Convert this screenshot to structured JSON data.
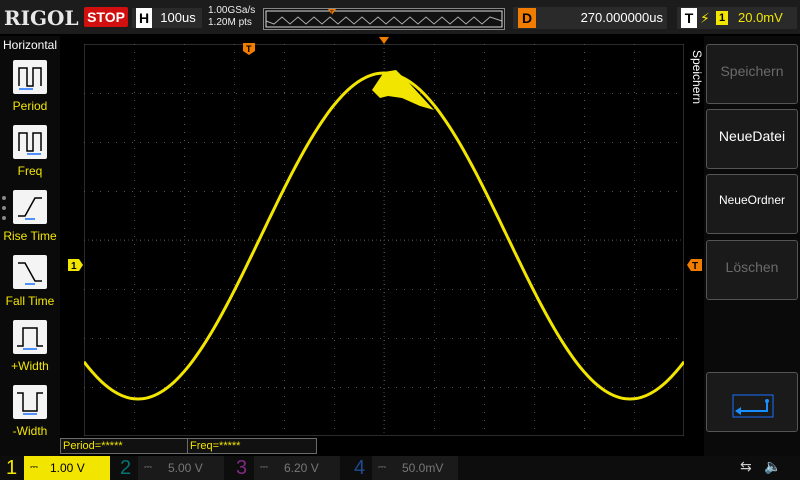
{
  "topbar": {
    "logo": "RIGOL",
    "run_state": "STOP",
    "horizontal_label": "H",
    "timebase": "100us",
    "sample_rate": "1.00GSa/s",
    "memory_depth": "1.20M pts",
    "delay_label": "D",
    "delay_value": "270.000000us",
    "trigger_label": "T",
    "trigger_source": "1",
    "trigger_level": "20.0mV"
  },
  "left_menu": {
    "title": "Horizontal",
    "items": [
      {
        "label": "Period",
        "icon": "period-icon"
      },
      {
        "label": "Freq",
        "icon": "freq-icon"
      },
      {
        "label": "Rise Time",
        "icon": "rise-time-icon"
      },
      {
        "label": "Fall Time",
        "icon": "fall-time-icon"
      },
      {
        "label": "+Width",
        "icon": "pos-width-icon"
      },
      {
        "label": "-Width",
        "icon": "neg-width-icon"
      }
    ]
  },
  "right_menu": {
    "title": "Speichern",
    "buttons": [
      {
        "label": "Speichern",
        "enabled": false
      },
      {
        "label": "NeueDatei",
        "enabled": true
      },
      {
        "label": "NeueOrdner",
        "enabled": true
      },
      {
        "label": "Löschen",
        "enabled": false
      }
    ],
    "back_icon": "return-arrow-icon"
  },
  "markers": {
    "trigger_pos": "T",
    "ch1_ref": "1",
    "trigger_level_ref": "T"
  },
  "measurements": {
    "period": "Period=*****",
    "freq": "Freq=*****"
  },
  "channels": [
    {
      "num": "1",
      "scale": "1.00 V",
      "color": "#f2e600",
      "active": true
    },
    {
      "num": "2",
      "scale": "5.00 V",
      "color": "#00c8c8",
      "active": false
    },
    {
      "num": "3",
      "scale": "6.20 V",
      "color": "#e040e0",
      "active": false
    },
    {
      "num": "4",
      "scale": "50.0mV",
      "color": "#2f7fff",
      "active": false
    }
  ],
  "colors": {
    "ch1": "#f2e600",
    "trigger": "#f07d00",
    "stop": "#d10f0f"
  }
}
